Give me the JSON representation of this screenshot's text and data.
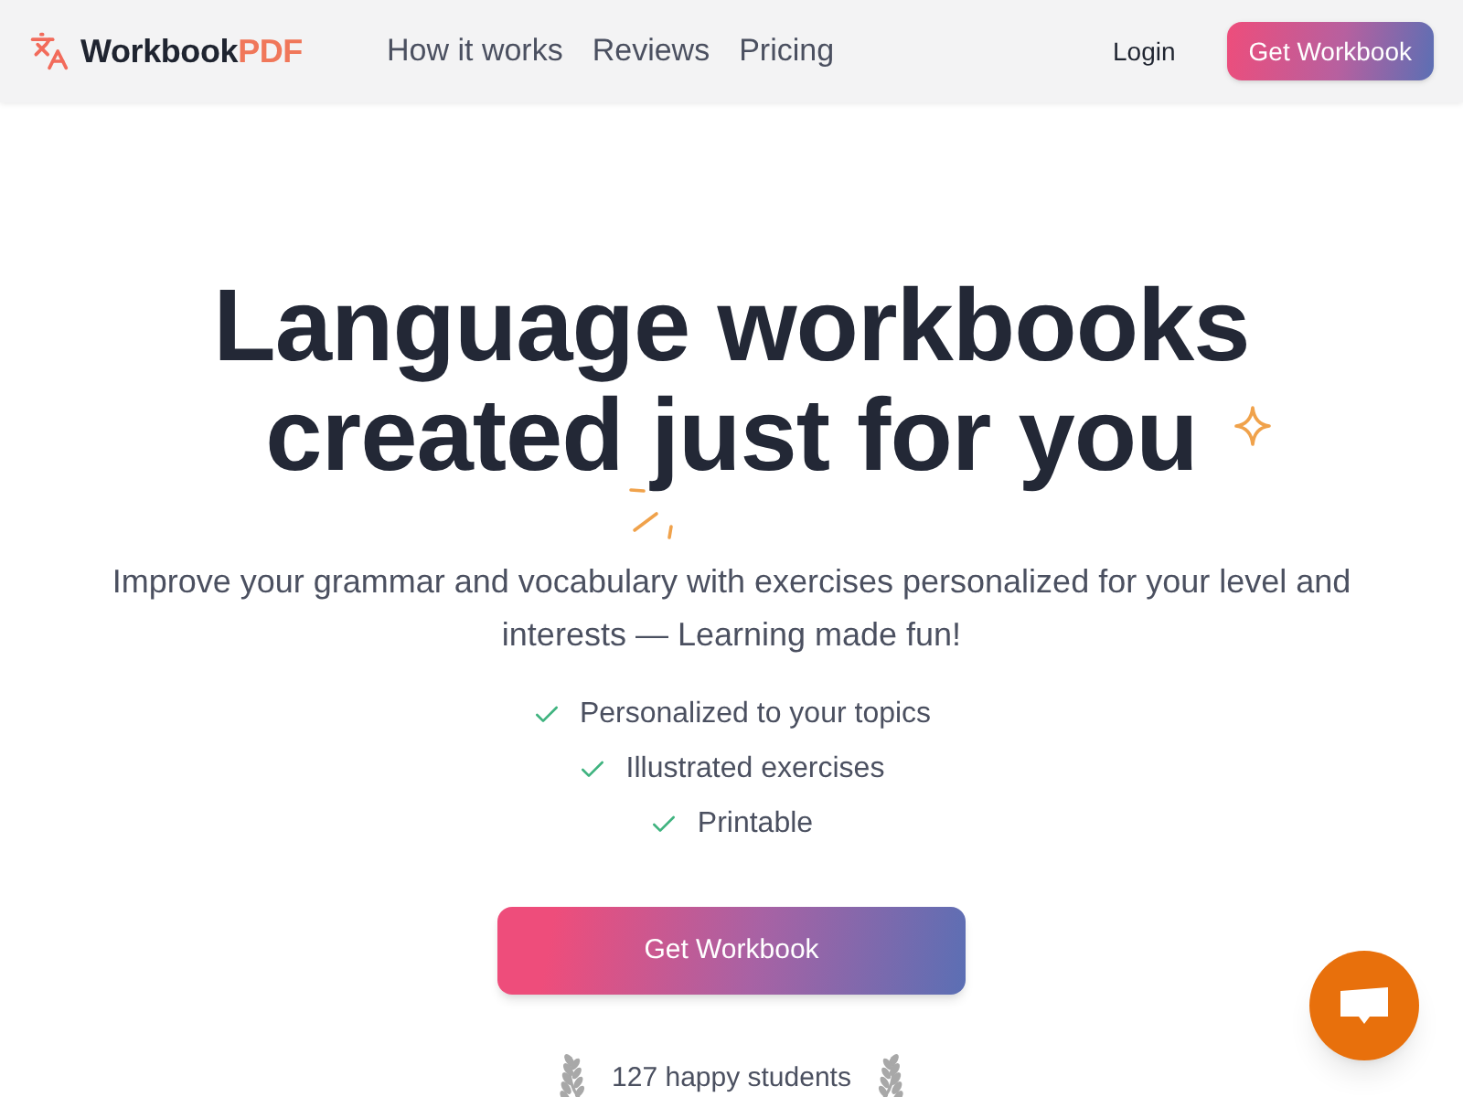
{
  "header": {
    "logo": {
      "name": "Workbook",
      "suffix": "PDF"
    },
    "nav": [
      {
        "label": "How it works"
      },
      {
        "label": "Reviews"
      },
      {
        "label": "Pricing"
      }
    ],
    "login": "Login",
    "cta": "Get Workbook"
  },
  "hero": {
    "title_lines": [
      "Language workbooks",
      "created just for you"
    ],
    "subtitle": "Improve your grammar and vocabulary with exercises personalized for your level and interests — Learning made fun!",
    "features": [
      "Personalized to your topics",
      "Illustrated exercises",
      "Printable"
    ],
    "cta": "Get Workbook",
    "social_proof": "127 happy students"
  }
}
